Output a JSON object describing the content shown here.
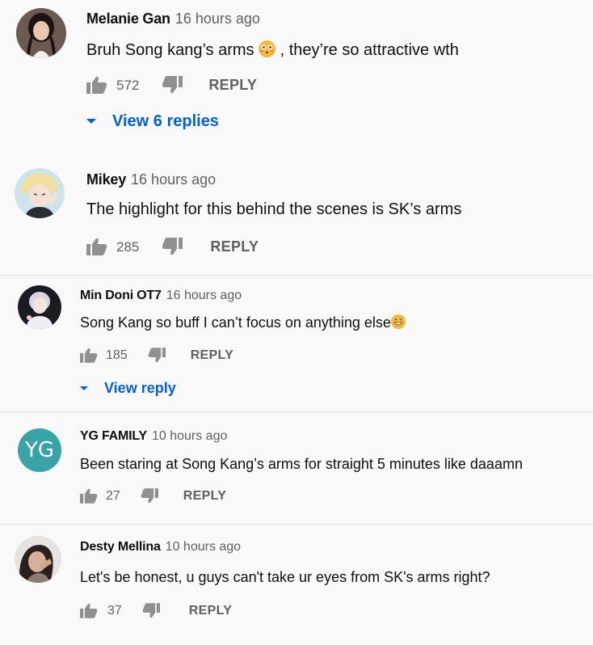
{
  "comments": [
    {
      "author": "Melanie Gan",
      "time": "16 hours ago",
      "text_before_emoji": "Bruh Song kang’s arms ",
      "emoji": "flushed-face",
      "text_after_emoji": " , they’re so attractive wth",
      "likes": "572",
      "reply_label": "REPLY",
      "view_replies": "View 6 replies"
    },
    {
      "author": "Mikey",
      "time": "16 hours ago",
      "text": "The highlight for this behind the scenes is SK’s arms",
      "likes": "285",
      "reply_label": "REPLY"
    },
    {
      "author": "Min Doni OT7",
      "time": "16 hours ago",
      "text_before_emoji": "Song Kang so buff I can’t focus on anything else",
      "emoji": "grinning-sweat-face",
      "likes": "185",
      "reply_label": "REPLY",
      "view_replies": "View reply"
    },
    {
      "author": "YG FAMILY",
      "time": "10 hours ago",
      "avatar_letters": "YG",
      "avatar_color": "#3aa3a8",
      "text": "Been staring at Song Kang’s arms for straight 5 minutes like daaamn",
      "likes": "27",
      "reply_label": "REPLY"
    },
    {
      "author": "Desty Mellina",
      "time": "10 hours ago",
      "text": "Let's be honest, u guys can't take ur eyes from SK's arms right?",
      "likes": "37",
      "reply_label": "REPLY"
    }
  ],
  "colors": {
    "link": "#065fd4",
    "muted": "#606060",
    "background": "#f9f9f9"
  }
}
